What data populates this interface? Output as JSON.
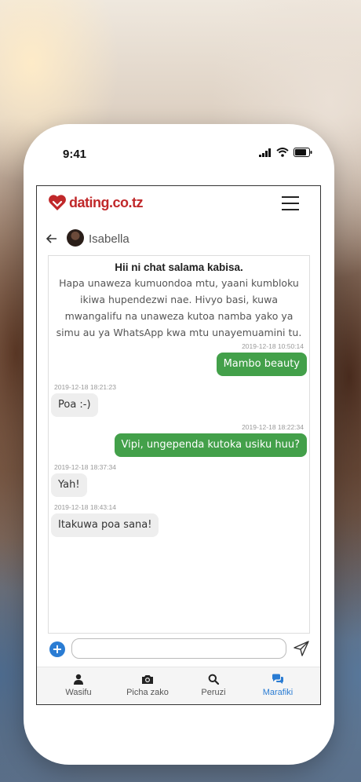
{
  "statusbar": {
    "time": "9:41"
  },
  "app": {
    "brand": "dating.co.tz",
    "accent": "#c0282a"
  },
  "chat": {
    "contact_name": "Isabella",
    "intro_title": "Hii ni chat salama kabisa.",
    "intro_body": "Hapa unaweza kumuondoa mtu, yaani kumbloku ikiwa hupendezwi nae. Hivyo basi, kuwa mwangalifu na unaweza kutoa namba yako ya simu au ya WhatsApp kwa mtu unayemuamini tu.",
    "messages": [
      {
        "direction": "out",
        "timestamp": "2019-12-18 10:50:14",
        "text": "Mambo beauty"
      },
      {
        "direction": "in",
        "timestamp": "2019-12-18 18:21:23",
        "text": "Poa :-)"
      },
      {
        "direction": "out",
        "timestamp": "2019-12-18 18:22:34",
        "text": "Vipi, ungependa kutoka usiku huu?"
      },
      {
        "direction": "in",
        "timestamp": "2019-12-18 18:37:34",
        "text": "Yah!"
      },
      {
        "direction": "in",
        "timestamp": "2019-12-18 18:43:14",
        "text": "Itakuwa poa sana!"
      }
    ],
    "composer_value": "",
    "colors": {
      "outgoing": "#43a04a",
      "incoming": "#eeeeee",
      "link": "#2a7cd3"
    }
  },
  "tabs": [
    {
      "label": "Wasifu",
      "icon": "user-icon",
      "active": false
    },
    {
      "label": "Picha zako",
      "icon": "camera-icon",
      "active": false
    },
    {
      "label": "Peruzi",
      "icon": "search-icon",
      "active": false
    },
    {
      "label": "Marafiki",
      "icon": "chat-bubbles-icon",
      "active": true
    }
  ]
}
